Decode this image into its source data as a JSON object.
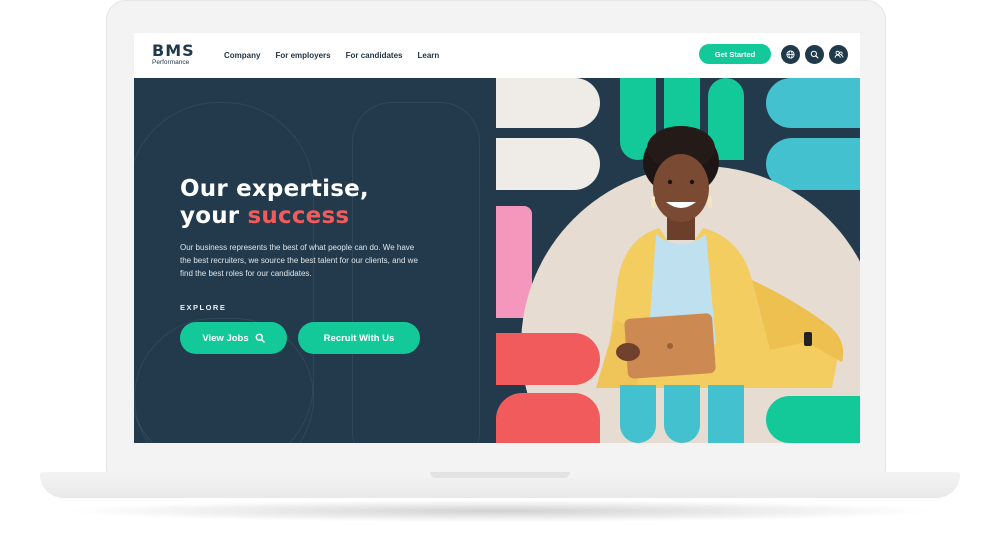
{
  "brand": {
    "logo_mark": "BMS",
    "logo_sub": "Performance"
  },
  "nav": {
    "links": [
      "Company",
      "For employers",
      "For candidates",
      "Learn"
    ],
    "cta_label": "Get Started",
    "icons": [
      "globe-icon",
      "search-icon",
      "users-icon"
    ]
  },
  "hero": {
    "title_line1": "Our expertise,",
    "title_line2_prefix": "your ",
    "title_line2_accent": "success",
    "description": "Our business represents the best of what people can do. We have the best recruiters, we source the best talent for our clients, and we find the best roles for our candidates.",
    "explore_label": "EXPLORE",
    "buttons": {
      "view_jobs": "View Jobs",
      "recruit": "Recruit With Us"
    }
  },
  "colors": {
    "navy": "#223a4c",
    "green": "#13c99a",
    "coral": "#f25b5b",
    "teal": "#44c1cf",
    "pink": "#f597bd",
    "cream": "#efebe6",
    "jacket_yellow": "#f3cd60"
  }
}
